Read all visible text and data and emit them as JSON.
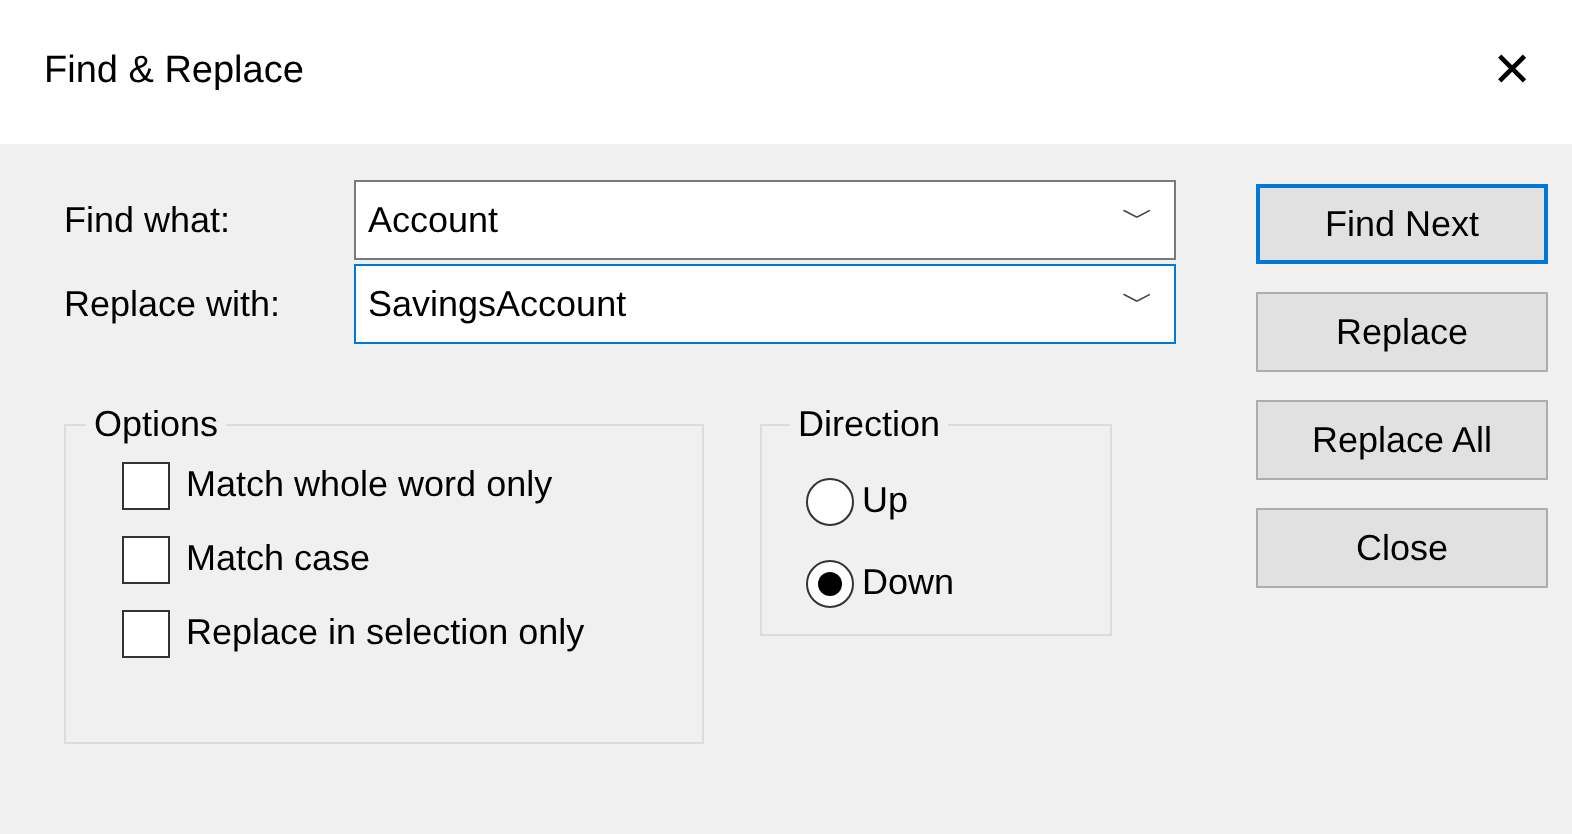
{
  "window": {
    "title": "Find & Replace",
    "close": "✕"
  },
  "fields": [
    {
      "label": "Find what:",
      "value": "Account",
      "focused": false,
      "arrow": "﹀"
    },
    {
      "label": "Replace with:",
      "value": "SavingsAccount",
      "focused": true,
      "arrow": "﹀"
    }
  ],
  "options": {
    "title": "Options",
    "items": [
      {
        "label": "Match whole word only",
        "checked": false
      },
      {
        "label": "Match case",
        "checked": false
      },
      {
        "label": "Replace in selection only",
        "checked": false
      }
    ]
  },
  "direction": {
    "title": "Direction",
    "items": [
      {
        "label": "Up",
        "selected": false
      },
      {
        "label": "Down",
        "selected": true
      }
    ]
  },
  "buttons": [
    {
      "label": "Find Next",
      "default": true
    },
    {
      "label": "Replace",
      "default": false
    },
    {
      "label": "Replace All",
      "default": false
    },
    {
      "label": "Close",
      "default": false
    }
  ]
}
